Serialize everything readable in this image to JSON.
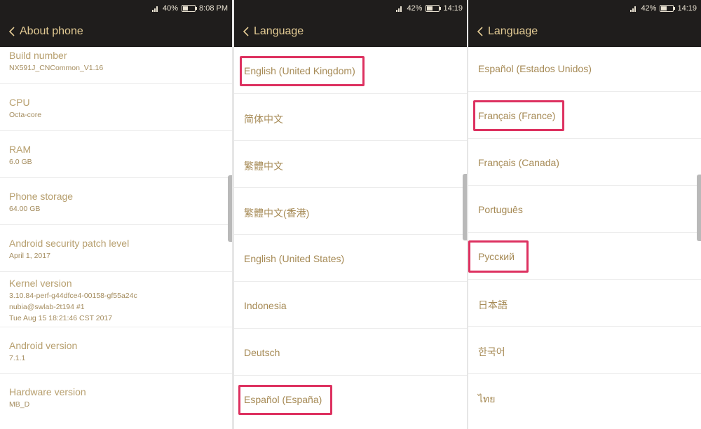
{
  "colors": {
    "bar_bg": "#1f1d1c",
    "title_gold": "#e3cb94",
    "text_gold": "#a68a55",
    "highlight": "#dd3160"
  },
  "panels": [
    {
      "status": {
        "battery": "40%",
        "time": "8:08 PM",
        "battery_level": 0.4
      },
      "title": "About phone",
      "items": [
        {
          "title": "Build number",
          "value": "NX591J_CNCommon_V1.16"
        },
        {
          "title": "CPU",
          "value": "Octa-core"
        },
        {
          "title": "RAM",
          "value": "6.0 GB"
        },
        {
          "title": "Phone storage",
          "value": "64.00 GB"
        },
        {
          "title": "Android security patch level",
          "value": "April 1, 2017"
        },
        {
          "title": "Kernel version",
          "value": "3.10.84-perf-g44dfce4-00158-gf55a24c",
          "value2": "nubia@swlab-2t194 #1",
          "value3": "Tue Aug 15 18:21:46 CST 2017"
        },
        {
          "title": "Android version",
          "value": "7.1.1"
        },
        {
          "title": "Hardware version",
          "value": "MB_D"
        }
      ]
    },
    {
      "status": {
        "battery": "42%",
        "time": "14:19",
        "battery_level": 0.42
      },
      "title": "Language",
      "items": [
        {
          "label": "English (United Kingdom)",
          "highlighted": true
        },
        {
          "label": "简体中文"
        },
        {
          "label": "繁體中文"
        },
        {
          "label": "繁體中文(香港)"
        },
        {
          "label": "English (United States)"
        },
        {
          "label": "Indonesia"
        },
        {
          "label": "Deutsch"
        },
        {
          "label": "Español (España)",
          "highlighted": true
        }
      ]
    },
    {
      "status": {
        "battery": "42%",
        "time": "14:19",
        "battery_level": 0.42
      },
      "title": "Language",
      "items": [
        {
          "label": "Español (Estados Unidos)"
        },
        {
          "label": "Français (France)",
          "highlighted": true
        },
        {
          "label": "Français (Canada)"
        },
        {
          "label": "Português"
        },
        {
          "label": "Русский",
          "highlighted": true
        },
        {
          "label": "日本語"
        },
        {
          "label": "한국어"
        },
        {
          "label": "ไทย"
        }
      ]
    }
  ]
}
